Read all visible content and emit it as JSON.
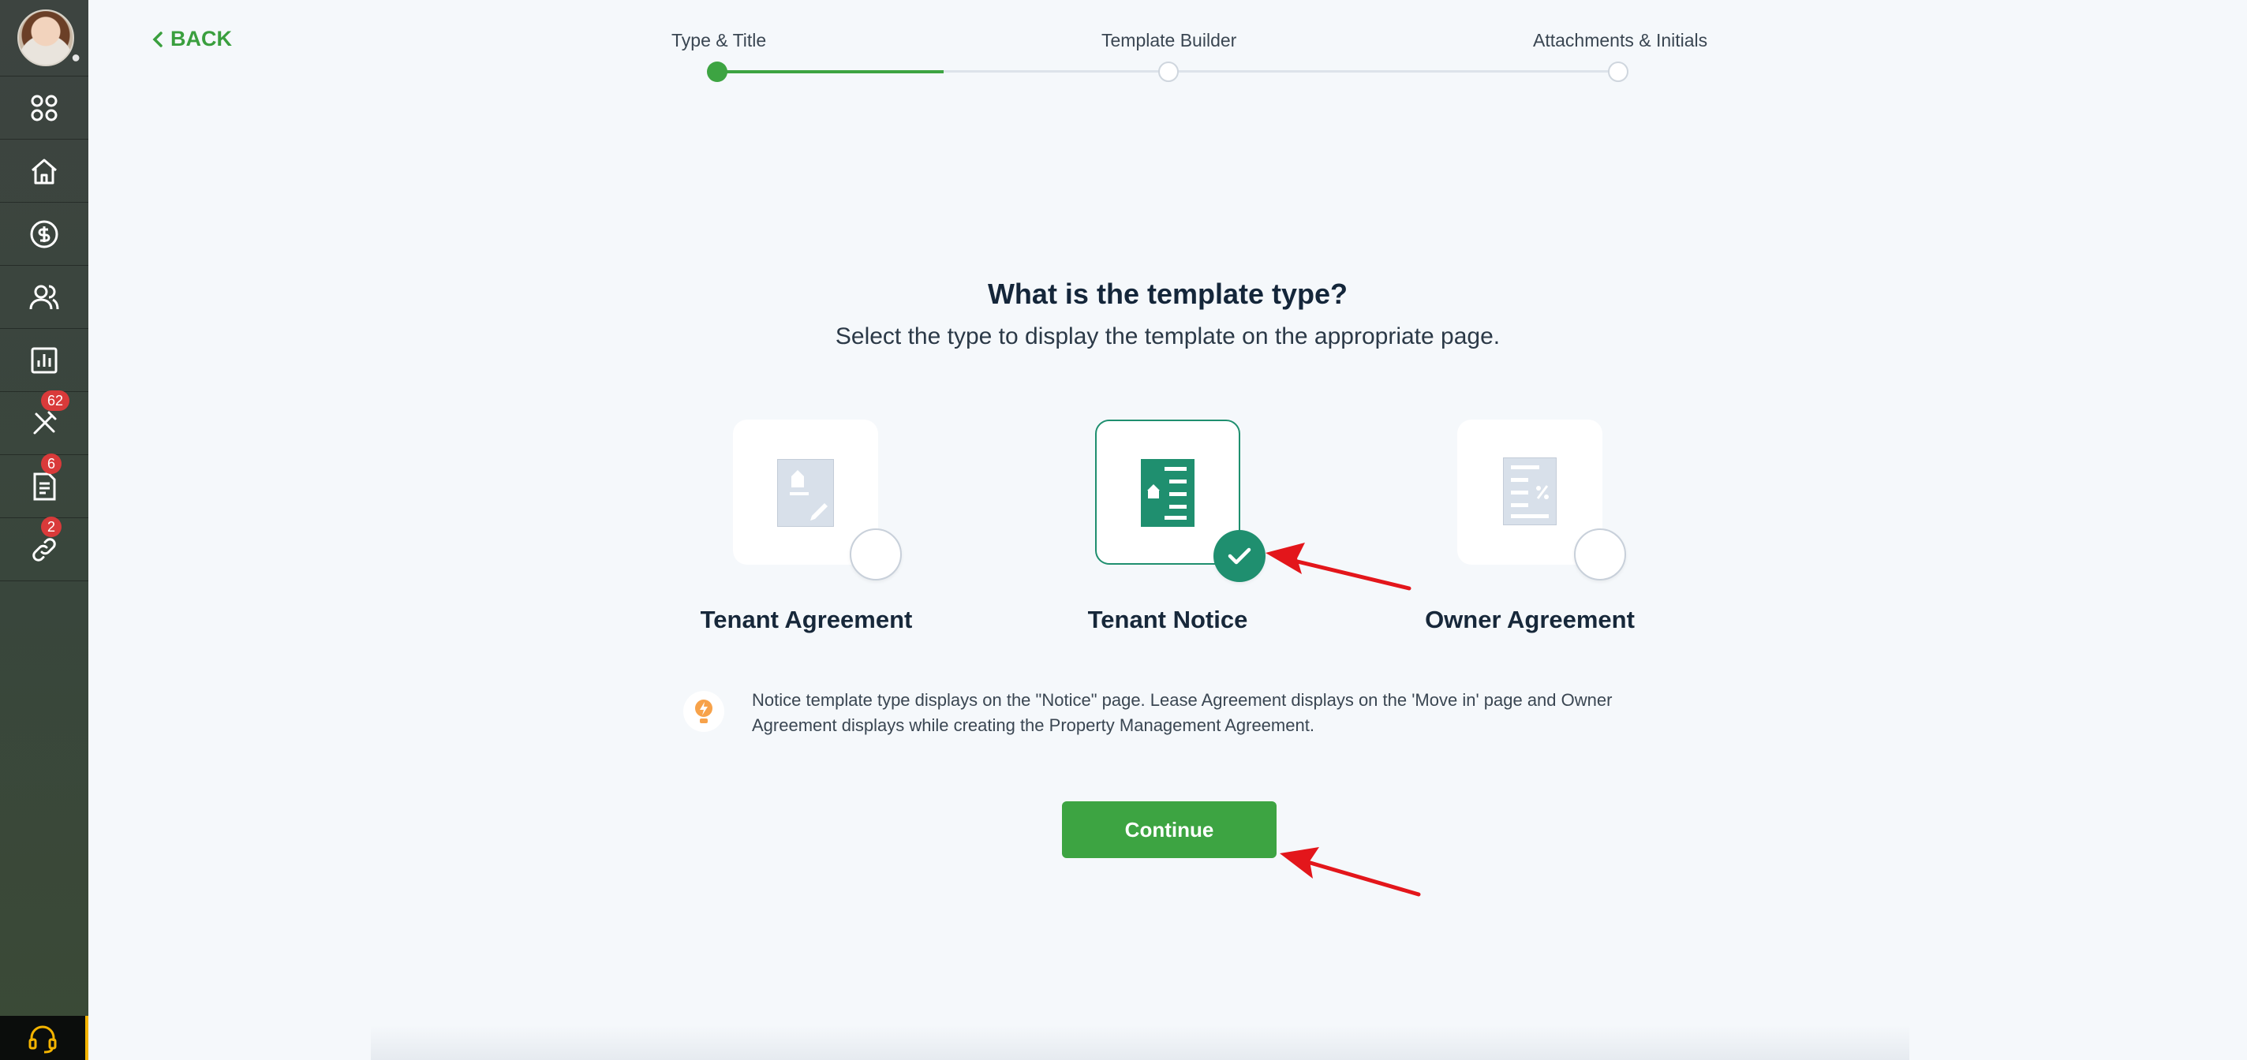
{
  "back": {
    "label": "BACK"
  },
  "stepper": {
    "steps": [
      {
        "label": "Type & Title",
        "state": "active"
      },
      {
        "label": "Template Builder",
        "state": "todo"
      },
      {
        "label": "Attachments & Initials",
        "state": "todo"
      }
    ]
  },
  "question": "What is the template type?",
  "subtitle": "Select the type to display the template on the appropriate page.",
  "options": [
    {
      "label": "Tenant Agreement",
      "selected": false,
      "icon": "agreement-doc-icon"
    },
    {
      "label": "Tenant Notice",
      "selected": true,
      "icon": "notice-doc-icon"
    },
    {
      "label": "Owner Agreement",
      "selected": false,
      "icon": "owner-doc-icon"
    }
  ],
  "tip": {
    "icon": "lightbulb-icon",
    "text": "Notice template type displays on the \"Notice\" page. Lease Agreement displays on the 'Move in' page and Owner Agreement displays while creating the Property Management Agreement."
  },
  "continue_label": "Continue",
  "sidebar": {
    "items": [
      {
        "icon": "apps-grid-icon"
      },
      {
        "icon": "home-icon"
      },
      {
        "icon": "dollar-icon"
      },
      {
        "icon": "people-icon"
      },
      {
        "icon": "chart-icon"
      },
      {
        "icon": "tools-icon",
        "badge": "62"
      },
      {
        "icon": "document-icon",
        "badge": "6"
      },
      {
        "icon": "link-icon",
        "badge": "2"
      }
    ],
    "support_icon": "headset-icon"
  },
  "colors": {
    "primary_green": "#3da442",
    "selected_teal": "#1f8f6f",
    "badge_red": "#d93a3a",
    "annotation_red": "#e3161b"
  }
}
